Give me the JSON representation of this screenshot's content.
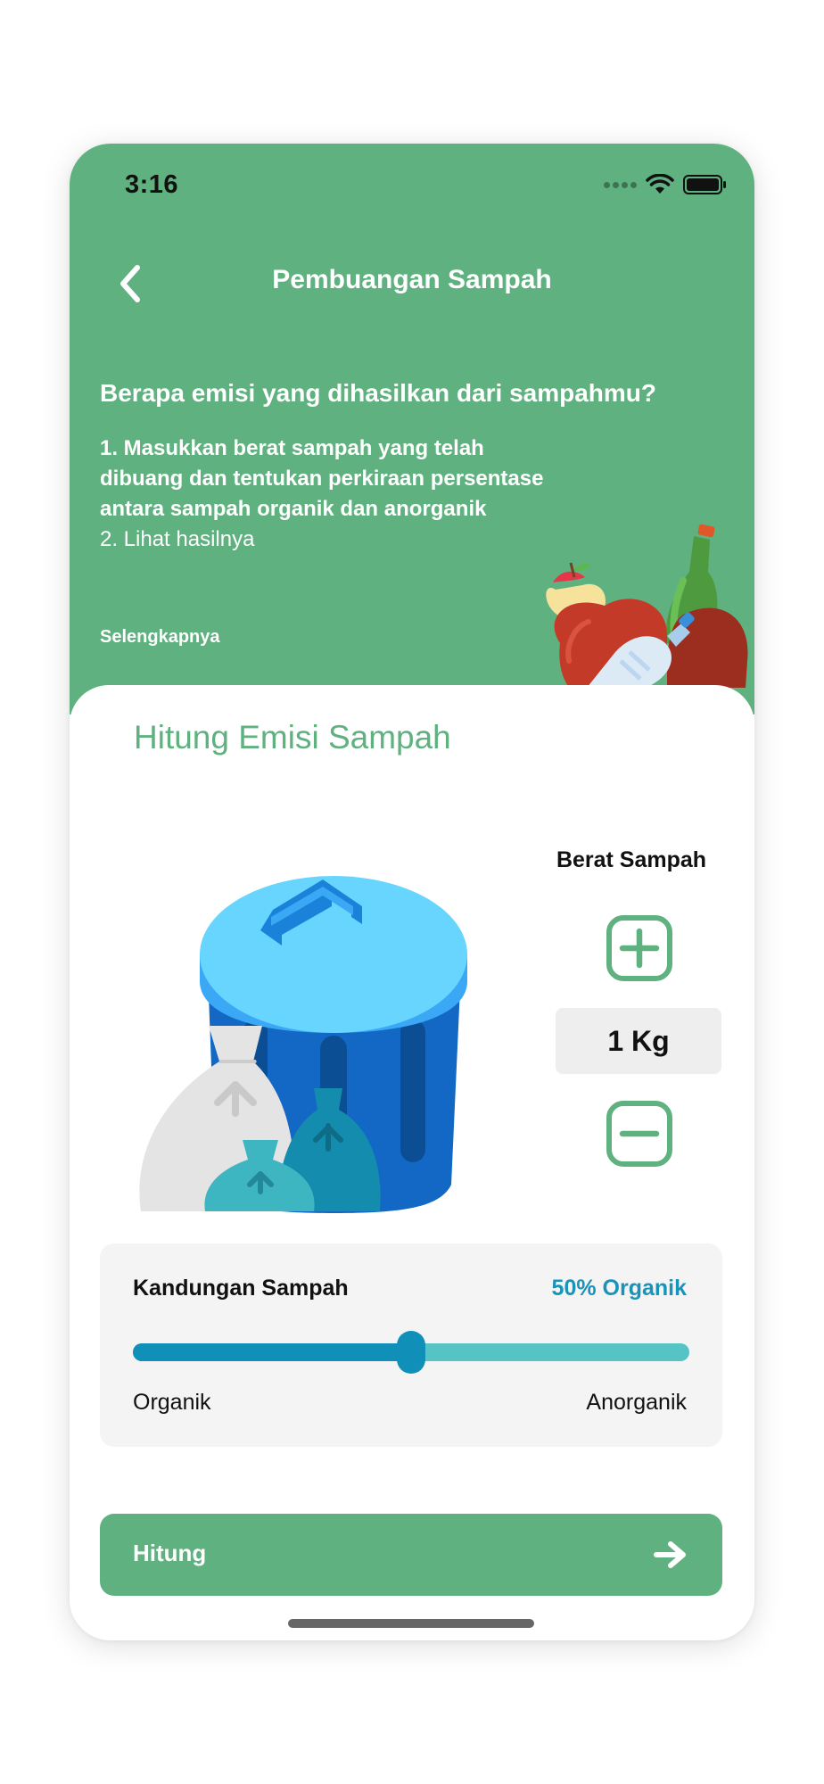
{
  "status_bar": {
    "time": "3:16"
  },
  "nav": {
    "title": "Pembuangan Sampah",
    "back_icon": "chevron-left-icon"
  },
  "intro": {
    "question": "Berapa emisi yang dihasilkan dari sampahmu?",
    "step1": "1. Masukkan berat sampah yang telah dibuang dan tentukan perkiraan persentase antara sampah organik dan anorganik",
    "step2": "2. Lihat hasilnya",
    "more_link": "Selengkapnya"
  },
  "calculator": {
    "title": "Hitung Emisi Sampah",
    "weight_label": "Berat Sampah",
    "weight_value": "1 Kg",
    "plus_icon": "plus-icon",
    "minus_icon": "minus-icon"
  },
  "composition": {
    "label": "Kandungan Sampah",
    "value_text": "50% Organik",
    "organic_fraction": 0.5,
    "left_label": "Organik",
    "right_label": "Anorganik"
  },
  "cta": {
    "label": "Hitung",
    "icon": "arrow-right-icon"
  },
  "colors": {
    "primary": "#5FB17F",
    "accent": "#1A93B9",
    "slider_fill": "#1090B8",
    "slider_track": "#56C4C4"
  }
}
